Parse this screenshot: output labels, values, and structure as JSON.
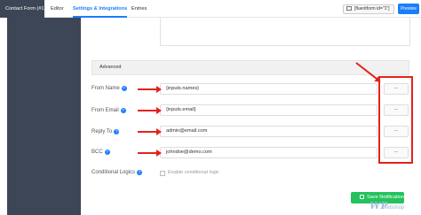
{
  "header": {
    "tabs": [
      {
        "label": "Contact Form (#1)"
      },
      {
        "label": "Editor"
      },
      {
        "label": "Settings & Integrations"
      },
      {
        "label": "Entries"
      }
    ],
    "shortcode": "[fluentform id=\"1\"]",
    "preview_label": "Preview"
  },
  "advanced": {
    "label": "Advanced"
  },
  "fields": [
    {
      "label": "From Name",
      "value": "{inputs.names}"
    },
    {
      "label": "From Email",
      "value": "{inputs.email}"
    },
    {
      "label": "Reply To",
      "value": "admin@email.com"
    },
    {
      "label": "BCC",
      "value": "johndoe@demo.com"
    }
  ],
  "dots_label": "...",
  "conditional": {
    "label": "Conditional Logics",
    "checkbox_label": "Enable conditional logic",
    "checked": false
  },
  "save_label": "Save Notification",
  "watermark": {
    "logo": "WP",
    "text": "Webshop"
  },
  "colors": {
    "accent": "#1a7efb",
    "sidebar": "#3c4656",
    "save": "#23c25d",
    "highlight": "#e2231a"
  }
}
